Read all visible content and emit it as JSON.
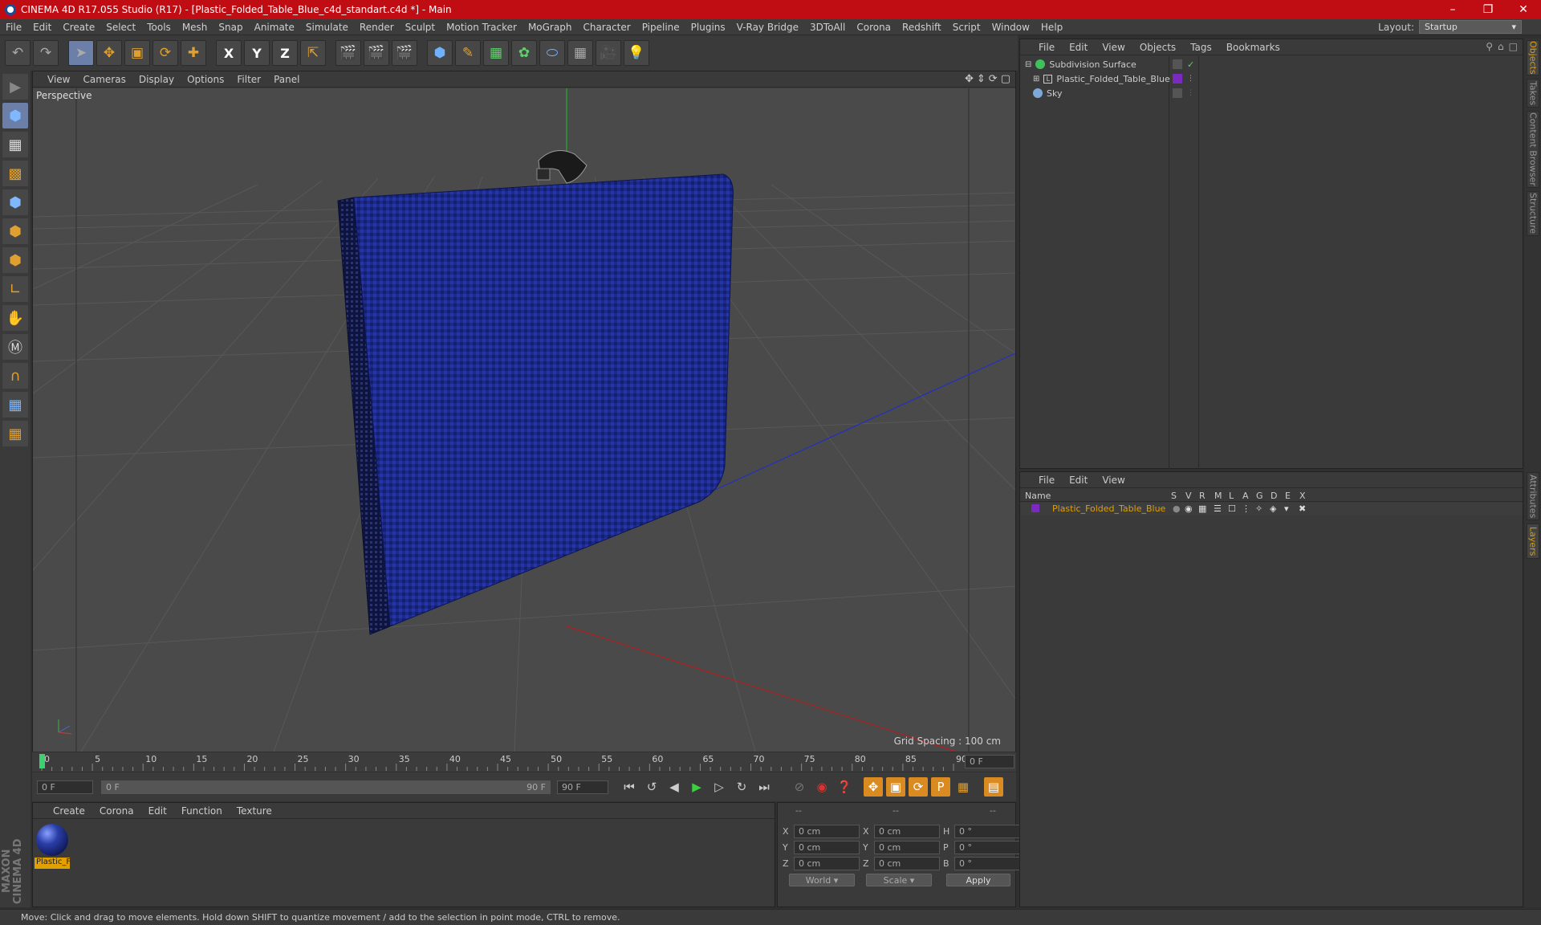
{
  "window": {
    "title": "CINEMA 4D R17.055 Studio (R17) - [Plastic_Folded_Table_Blue_c4d_standart.c4d *] - Main"
  },
  "menu": [
    "File",
    "Edit",
    "Create",
    "Select",
    "Tools",
    "Mesh",
    "Snap",
    "Animate",
    "Simulate",
    "Render",
    "Sculpt",
    "Motion Tracker",
    "MoGraph",
    "Character",
    "Pipeline",
    "Plugins",
    "V-Ray Bridge",
    "3DToAll",
    "Corona",
    "Redshift",
    "Script",
    "Window",
    "Help"
  ],
  "layout": {
    "label": "Layout:",
    "value": "Startup"
  },
  "viewport": {
    "menu": [
      "View",
      "Cameras",
      "Display",
      "Options",
      "Filter",
      "Panel"
    ],
    "label": "Perspective",
    "grid_spacing": "Grid Spacing : 100 cm"
  },
  "timeline": {
    "ticks": [
      "0",
      "5",
      "10",
      "15",
      "20",
      "25",
      "30",
      "35",
      "40",
      "45",
      "50",
      "55",
      "60",
      "65",
      "70",
      "75",
      "80",
      "85",
      "90"
    ],
    "current": "0 F",
    "start": "0 F",
    "range_start": "0 F",
    "range_end": "90 F",
    "end": "90 F"
  },
  "materials": {
    "menu": [
      "Create",
      "Corona",
      "Edit",
      "Function",
      "Texture"
    ],
    "items": [
      {
        "name": "Plastic_F"
      }
    ]
  },
  "coords": {
    "header": [
      "--",
      "--",
      "--"
    ],
    "rows": [
      {
        "a1": "X",
        "v1": "0 cm",
        "a2": "X",
        "v2": "0 cm",
        "a3": "H",
        "v3": "0 °"
      },
      {
        "a1": "Y",
        "v1": "0 cm",
        "a2": "Y",
        "v2": "0 cm",
        "a3": "P",
        "v3": "0 °"
      },
      {
        "a1": "Z",
        "v1": "0 cm",
        "a2": "Z",
        "v2": "0 cm",
        "a3": "B",
        "v3": "0 °"
      }
    ],
    "world": "World",
    "scale": "Scale",
    "apply": "Apply"
  },
  "objects": {
    "menu": [
      "File",
      "Edit",
      "View",
      "Objects",
      "Tags",
      "Bookmarks"
    ],
    "items": [
      {
        "name": "Subdivision Surface"
      },
      {
        "name": "Plastic_Folded_Table_Blue"
      },
      {
        "name": "Sky"
      }
    ]
  },
  "layers": {
    "menu": [
      "File",
      "Edit",
      "View"
    ],
    "columns": [
      "Name",
      "S",
      "V",
      "R",
      "M",
      "L",
      "A",
      "G",
      "D",
      "E",
      "X"
    ],
    "items": [
      {
        "name": "Plastic_Folded_Table_Blue"
      }
    ]
  },
  "side_tabs": [
    "Objects",
    "Takes",
    "Content Browser",
    "Structure",
    "Attributes",
    "Layers"
  ],
  "status": "Move: Click and drag to move elements. Hold down SHIFT to quantize movement / add to the selection in point mode, CTRL to remove.",
  "branding": "MAXON CINEMA 4D",
  "colors": {
    "title_bar": "#c00d14",
    "accent": "#e0a000",
    "selected_tool": "#6b7fa8"
  }
}
